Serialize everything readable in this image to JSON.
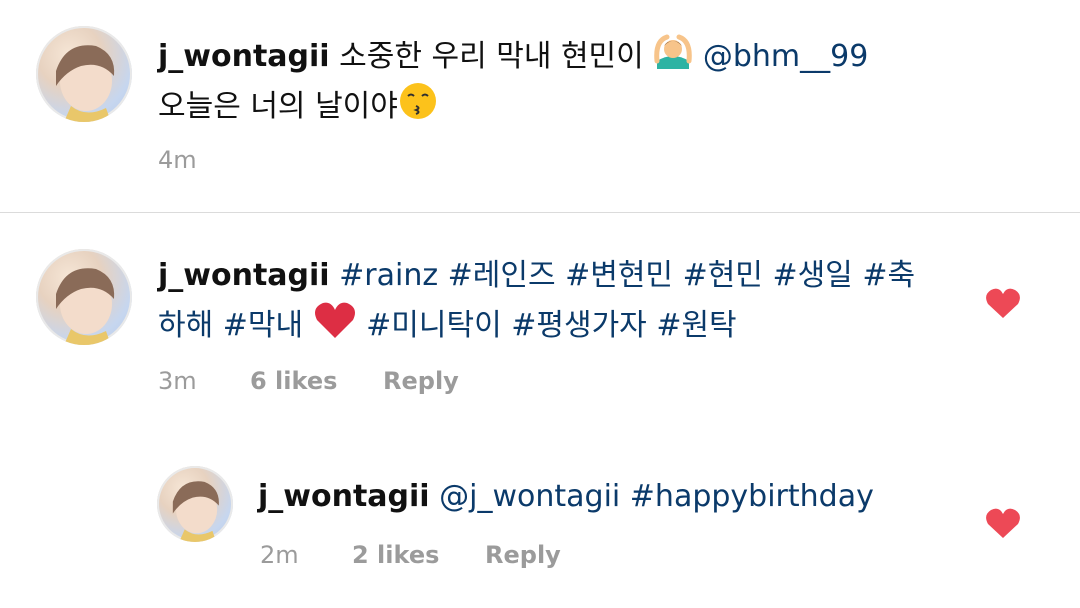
{
  "caption": {
    "username": "j_wontagii",
    "text_part1": "소중한 우리 막내 현민이",
    "mention": "@bhm__99",
    "text_line2": "오늘은 너의 날이야",
    "emoji1": "man-gesturing-ok-icon",
    "emoji2": "kissing-face-icon",
    "time": "4m"
  },
  "comment1": {
    "username": "j_wontagii",
    "tags_line1": "#rainz #레인즈 #변현민 #현민 #생일 #축",
    "tags_line2a": "하해 #막내",
    "tags_line2b": "#미니탁이 #평생가자 #원탁",
    "emoji": "red-heart-icon",
    "time": "3m",
    "likes": "6 likes",
    "reply_label": "Reply",
    "like_icon": "heart-icon",
    "like_color": "#ed4956"
  },
  "reply1": {
    "username": "j_wontagii",
    "mention": "@j_wontagii",
    "tag": "#happybirthday",
    "time": "2m",
    "likes": "2 likes",
    "reply_label": "Reply",
    "like_icon": "heart-icon",
    "like_color": "#ed4956"
  }
}
